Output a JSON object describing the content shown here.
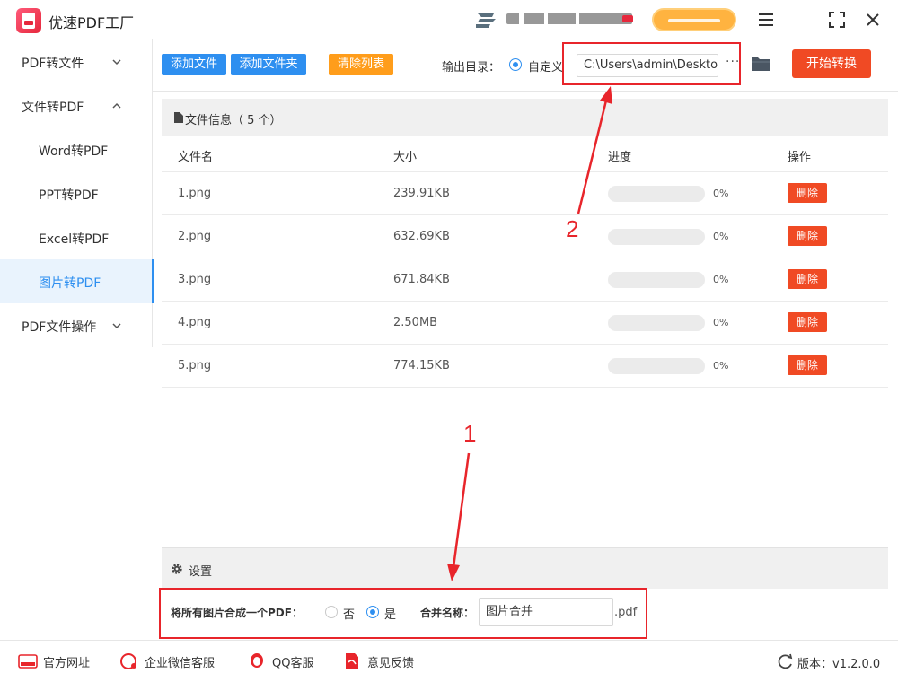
{
  "app": {
    "title": "优速PDF工厂"
  },
  "sidebar": {
    "items": [
      {
        "label": "PDF转文件",
        "type": "group",
        "expanded": false
      },
      {
        "label": "文件转PDF",
        "type": "group",
        "expanded": true
      },
      {
        "label": "Word转PDF",
        "type": "sub"
      },
      {
        "label": "PPT转PDF",
        "type": "sub"
      },
      {
        "label": "Excel转PDF",
        "type": "sub"
      },
      {
        "label": "图片转PDF",
        "type": "sub",
        "active": true
      },
      {
        "label": "PDF文件操作",
        "type": "group",
        "expanded": false
      }
    ]
  },
  "toolbar": {
    "add_file": "添加文件",
    "add_folder": "添加文件夹",
    "clear_list": "清除列表",
    "output_label": "输出目录：",
    "custom_label": "自定义",
    "output_path": "C:\\Users\\admin\\Deskto",
    "more": "···",
    "start": "开始转换"
  },
  "file_info": {
    "title": "文件信息（ 5 个）"
  },
  "table": {
    "columns": [
      "文件名",
      "大小",
      "进度",
      "操作"
    ],
    "rows": [
      {
        "name": "1.png",
        "size": "239.91KB",
        "progress": "0%",
        "progress_value": 0,
        "action": "删除"
      },
      {
        "name": "2.png",
        "size": "632.69KB",
        "progress": "0%",
        "progress_value": 0,
        "action": "删除"
      },
      {
        "name": "3.png",
        "size": "671.84KB",
        "progress": "0%",
        "progress_value": 0,
        "action": "删除"
      },
      {
        "name": "4.png",
        "size": "2.50MB",
        "progress": "0%",
        "progress_value": 0,
        "action": "删除"
      },
      {
        "name": "5.png",
        "size": "774.15KB",
        "progress": "0%",
        "progress_value": 0,
        "action": "删除"
      }
    ]
  },
  "settings": {
    "title": "设置",
    "merge_label": "将所有图片合成一个PDF：",
    "option_no": "否",
    "option_yes": "是",
    "merge_selected": "是",
    "merge_name_label": "合并名称：",
    "merge_name_value": "图片合并",
    "suffix": ".pdf"
  },
  "annotations": {
    "one": "1",
    "two": "2"
  },
  "footer": {
    "website": "官方网址",
    "wechat": "企业微信客服",
    "qq": "QQ客服",
    "feedback": "意见反馈",
    "version": "版本：v1.2.0.0"
  },
  "colors": {
    "accent": "#2e8ff0",
    "danger": "#f04a24",
    "warning": "#ff9d1b",
    "annotation": "#e8252b"
  }
}
